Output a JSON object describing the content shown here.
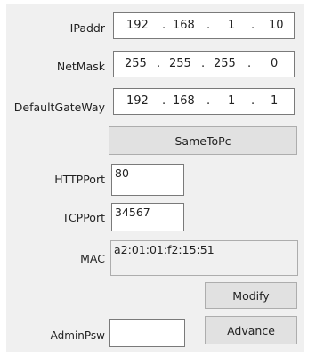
{
  "labels": {
    "ipaddr": "IPaddr",
    "netmask": "NetMask",
    "gateway": "DefaultGateWay",
    "httpport": "HTTPPort",
    "tcpport": "TCPPort",
    "mac": "MAC",
    "adminpsw": "AdminPsw"
  },
  "ipaddr": [
    "192",
    "168",
    "1",
    "10"
  ],
  "netmask": [
    "255",
    "255",
    "255",
    "0"
  ],
  "gateway": [
    "192",
    "168",
    "1",
    "1"
  ],
  "separator": ".",
  "httpport": "80",
  "tcpport": "34567",
  "mac": "a2:01:01:f2:15:51",
  "adminpsw": "",
  "buttons": {
    "sametopc": "SameToPc",
    "modify": "Modify",
    "advance": "Advance"
  }
}
